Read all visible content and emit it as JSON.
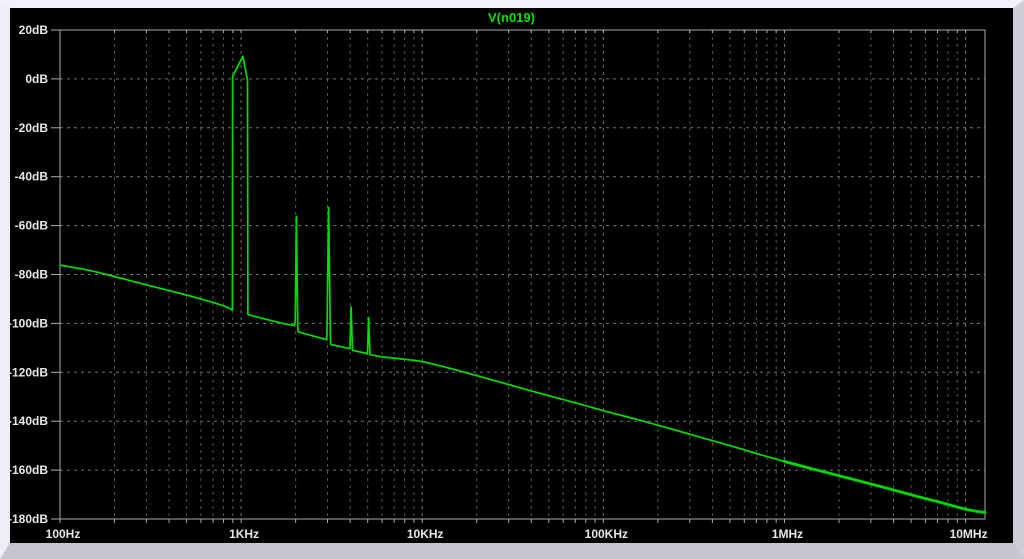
{
  "window": {
    "title": "V(n019)"
  },
  "colors": {
    "background": "#000000",
    "frame": "#ababb2",
    "grid_minor": "#555555",
    "grid_major": "#757575",
    "axis_label": "#e8e8e8",
    "trace_green": "#00dc00",
    "title_green": "#00e000",
    "border_light": "#f2f2fa",
    "border_shade": "#c6c6d2"
  },
  "chart_data": {
    "type": "line",
    "title": "V(n019)",
    "legend_position": "top-center",
    "grid": true,
    "x_axis": {
      "scale": "log",
      "unit": "Hz",
      "min": 100,
      "max": 12800000,
      "tick_values": [
        100,
        1000,
        10000,
        100000,
        1000000,
        10000000
      ],
      "tick_labels": [
        "100Hz",
        "1KHz",
        "10KHz",
        "100KHz",
        "1MHz",
        "10MHz"
      ]
    },
    "y_axis": {
      "unit": "dB",
      "min": -180,
      "max": 20,
      "step": 20,
      "tick_labels": [
        "20dB",
        "0dB",
        "-20dB",
        "-40dB",
        "-60dB",
        "-80dB",
        "-100dB",
        "-120dB",
        "-140dB",
        "-160dB",
        "-180dB"
      ]
    },
    "peaks": [
      {
        "freq_hz": 1000,
        "level_db": 9.3
      },
      {
        "freq_hz": 2000,
        "level_db": -56.2
      },
      {
        "freq_hz": 3000,
        "level_db": -52.6
      },
      {
        "freq_hz": 4000,
        "level_db": -93.3
      },
      {
        "freq_hz": 5000,
        "level_db": -97.6
      }
    ],
    "series": [
      {
        "name": "V(n019)",
        "color": "#00dc00",
        "points": [
          [
            100,
            -76.2
          ],
          [
            130,
            -77.6
          ],
          [
            160,
            -79.0
          ],
          [
            200,
            -80.8
          ],
          [
            250,
            -82.7
          ],
          [
            300,
            -84.2
          ],
          [
            400,
            -86.6
          ],
          [
            500,
            -88.4
          ],
          [
            600,
            -90.0
          ],
          [
            700,
            -91.4
          ],
          [
            800,
            -92.8
          ],
          [
            860,
            -93.8
          ],
          [
            895,
            -94.5
          ],
          [
            897,
            1.0
          ],
          [
            1023,
            9.3
          ],
          [
            1085,
            -0.5
          ],
          [
            1090,
            -96.3
          ],
          [
            1200,
            -97.2
          ],
          [
            1400,
            -98.5
          ],
          [
            1700,
            -100.0
          ],
          [
            1960,
            -100.9
          ],
          [
            1990,
            -99.5
          ],
          [
            2020,
            -56.2
          ],
          [
            2052,
            -100.5
          ],
          [
            2060,
            -103.4
          ],
          [
            2300,
            -104.4
          ],
          [
            2600,
            -105.5
          ],
          [
            2950,
            -106.6
          ],
          [
            2975,
            -105.5
          ],
          [
            3040,
            -52.6
          ],
          [
            3110,
            -106.0
          ],
          [
            3125,
            -108.6
          ],
          [
            3500,
            -109.4
          ],
          [
            3970,
            -110.3
          ],
          [
            3985,
            -110.4
          ],
          [
            4050,
            -93.3
          ],
          [
            4120,
            -111.0
          ],
          [
            4950,
            -112.3
          ],
          [
            4985,
            -112.4
          ],
          [
            5060,
            -97.6
          ],
          [
            5150,
            -112.8
          ],
          [
            6000,
            -113.7
          ],
          [
            7000,
            -114.2
          ],
          [
            8500,
            -114.9
          ],
          [
            10000,
            -115.6
          ],
          [
            13000,
            -117.6
          ],
          [
            17000,
            -119.9
          ],
          [
            22000,
            -122.2
          ],
          [
            30000,
            -125.0
          ],
          [
            40000,
            -127.6
          ],
          [
            55000,
            -130.4
          ],
          [
            75000,
            -133.1
          ],
          [
            100000,
            -135.7
          ],
          [
            140000,
            -138.5
          ],
          [
            190000,
            -141.2
          ],
          [
            260000,
            -144.0
          ],
          [
            360000,
            -147.0
          ],
          [
            500000,
            -150.0
          ],
          [
            700000,
            -153.2
          ],
          [
            1000000,
            -156.5
          ],
          [
            1400000,
            -159.3
          ],
          [
            2000000,
            -162.3
          ],
          [
            2800000,
            -165.1
          ],
          [
            4000000,
            -168.1
          ],
          [
            5500000,
            -170.9
          ],
          [
            7000000,
            -172.9
          ],
          [
            8500000,
            -174.6
          ],
          [
            10000000,
            -176.0
          ],
          [
            11500000,
            -176.9
          ],
          [
            12800000,
            -177.3
          ]
        ]
      }
    ]
  }
}
